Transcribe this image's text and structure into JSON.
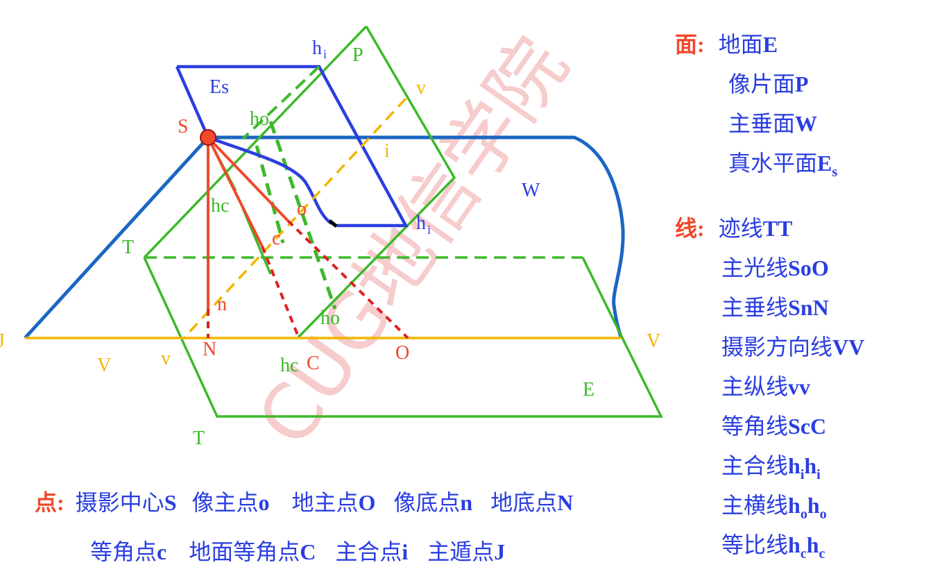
{
  "colors": {
    "plane_green": "#3cb92a",
    "trace_blue": "#1b66c2",
    "photo_blue": "#2a3ee0",
    "ray_red": "#f0492c",
    "axis_yellow": "#f2b500",
    "watermark": "#f6cccc"
  },
  "watermark": "CUG地信学院",
  "diagram_labels": {
    "hi_top": "h",
    "hi_top_sub": "i",
    "P": "P",
    "Es": "Es",
    "v_small_top": "v",
    "S": "S",
    "ho_top": "ho",
    "i": "i",
    "W": "W",
    "hc_left": "hc",
    "o": "o",
    "hi_right": "h",
    "hi_right_sub": "i",
    "c": "c",
    "T_upper": "T",
    "n": "n",
    "ho_bottom": "ho",
    "J": "J",
    "V_right": "V",
    "V_left": "V",
    "v_small_left": "v",
    "N": "N",
    "O": "O",
    "hc_bottom": "hc",
    "C": "C",
    "E": "E",
    "T_lower": "T"
  },
  "legend": {
    "faces_heading": "面",
    "faces": [
      {
        "text": "地面",
        "bold": "E",
        "sub": ""
      },
      {
        "text": "像片面",
        "bold": "P",
        "sub": ""
      },
      {
        "text": "主垂面",
        "bold": "W",
        "sub": ""
      },
      {
        "text": "真水平面",
        "bold": "E",
        "sub": "s"
      }
    ],
    "lines_heading": "线",
    "lines": [
      {
        "text": "迹线",
        "bold": "TT"
      },
      {
        "text": "主光线",
        "bold": "SoO"
      },
      {
        "text": "主垂线",
        "bold": "SnN"
      },
      {
        "text": "摄影方向线",
        "bold": "VV"
      },
      {
        "text": "主纵线",
        "bold": "vv"
      },
      {
        "text": "等角线",
        "bold": "ScC"
      },
      {
        "text": "主合线",
        "bold": "h",
        "sub": "i",
        "bold2": "h",
        "sub2": "i"
      },
      {
        "text": "主横线",
        "bold": "h",
        "sub": "o",
        "bold2": "h",
        "sub2": "o"
      },
      {
        "text": "等比线",
        "bold": "h",
        "sub": "c",
        "bold2": "h",
        "sub2": "c"
      }
    ],
    "points_heading": "点",
    "points_row1": [
      {
        "text": "摄影中心",
        "bold": "S"
      },
      {
        "text": "像主点",
        "bold": "o"
      },
      {
        "text": "地主点",
        "bold": "O"
      },
      {
        "text": "像底点",
        "bold": "n"
      },
      {
        "text": "地底点",
        "bold": "N"
      }
    ],
    "points_row2": [
      {
        "text": "等角点",
        "bold": "c"
      },
      {
        "text": "地面等角点",
        "bold": "C"
      },
      {
        "text": "主合点",
        "bold": "i"
      },
      {
        "text": "主遁点",
        "bold": "J"
      }
    ]
  }
}
